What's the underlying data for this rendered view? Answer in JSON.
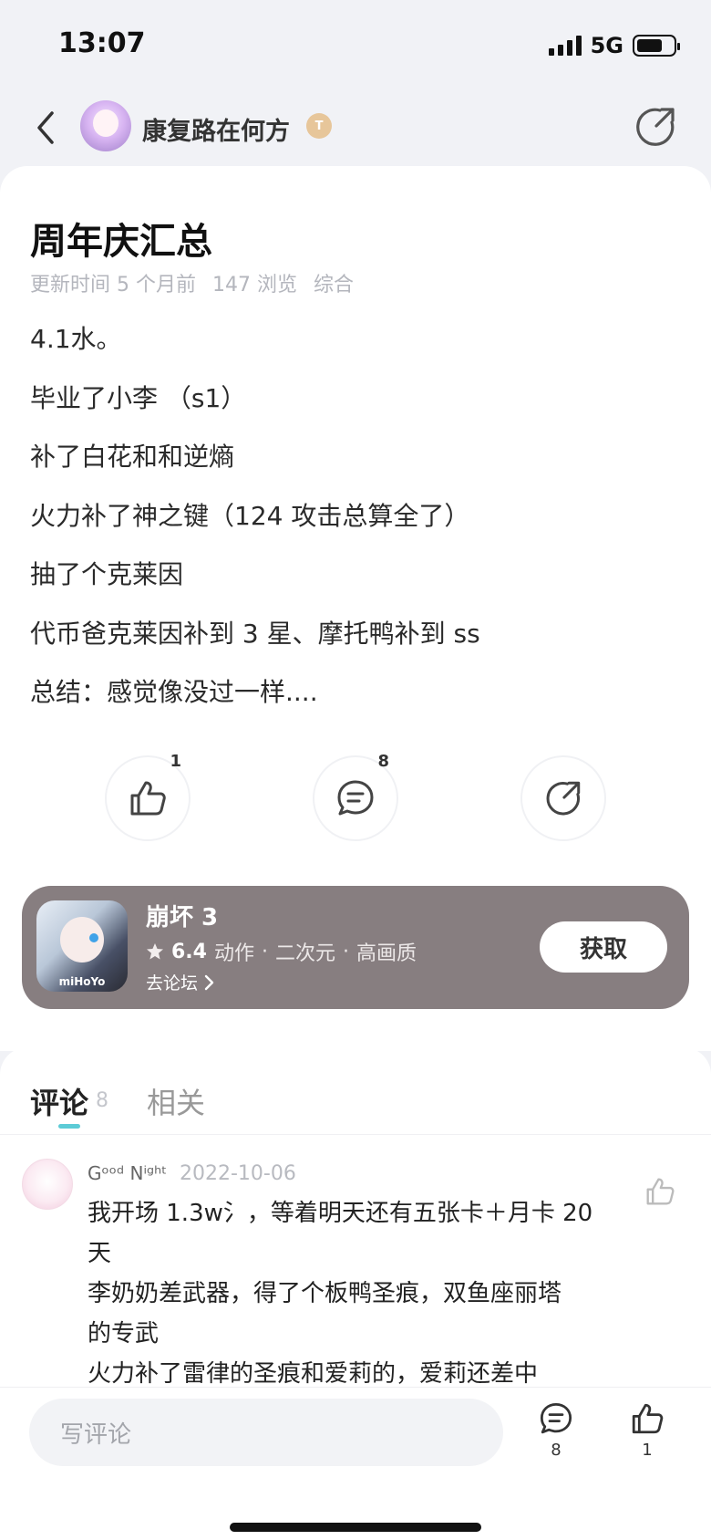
{
  "status_bar": {
    "time": "13:07",
    "network": "5G"
  },
  "header": {
    "author_name": "康复路在何方",
    "level_badge": "T"
  },
  "post": {
    "title": "周年庆汇总",
    "meta": {
      "updated": "更新时间 5 个月前",
      "views": "147 浏览",
      "category": "综合"
    },
    "lines": [
      "4.1水。",
      "毕业了小李 （s1）",
      "补了白花和和逆熵",
      "火力补了神之键（124 攻击总算全了）",
      "抽了个克莱因",
      "代币爸克莱因补到 3 星、摩托鸭补到 ss",
      "总结：感觉像没过一样...."
    ]
  },
  "actions": {
    "like_count": "1",
    "comment_count": "8"
  },
  "game": {
    "name": "崩坏 3",
    "rating": "6.4",
    "tags": [
      "动作",
      "二次元",
      "高画质"
    ],
    "separator": "·",
    "forum_link": "去论坛",
    "get_button": "获取",
    "icon_brand": "miHoYo"
  },
  "tabs": {
    "comments_label": "评论",
    "comments_count": "8",
    "related_label": "相关"
  },
  "comment": {
    "author": "Gᵒᵒᵈ Nⁱᵍʰᵗ",
    "date": "2022-10-06",
    "text_lines": [
      "我开场 1.3w氵，等着明天还有五张卡＋月卡 20",
      "天",
      "李奶奶差武器，得了个板鸭圣痕，双鱼座丽塔",
      "的专武",
      "火力补了雷律的圣痕和爱莉的，爱莉还差中"
    ]
  },
  "bottom_bar": {
    "input_placeholder": "写评论",
    "comment_count": "8",
    "like_count": "1"
  },
  "colors": {
    "accent": "#5ccbd6",
    "game_card": "#877e80",
    "background": "#f1f2f6"
  }
}
